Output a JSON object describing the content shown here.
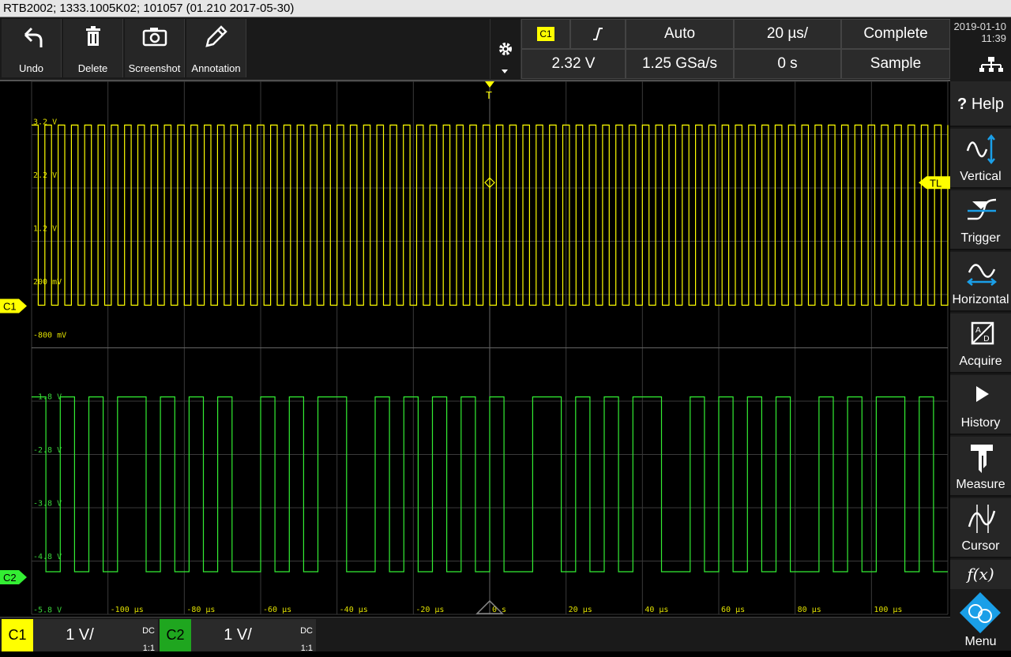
{
  "window": {
    "title": "RTB2002; 1333.1005K02; 101057 (01.210 2017-05-30)"
  },
  "toolbar": {
    "buttons": [
      {
        "label": "Undo",
        "icon": "undo-icon"
      },
      {
        "label": "Delete",
        "icon": "trash-icon"
      },
      {
        "label": "Screenshot",
        "icon": "camera-icon"
      },
      {
        "label": "Annotation",
        "icon": "pencil-icon"
      }
    ]
  },
  "settings": {
    "trigger_source": "C1",
    "trigger_level": "2.32 V",
    "trigger_mode": "Auto",
    "sample_rate": "1.25 GSa/s",
    "timebase": "20 µs/",
    "position": "0 s",
    "acq_status": "Complete",
    "acq_mode": "Sample"
  },
  "datetime": {
    "date": "2019-01-10",
    "time": "11:39"
  },
  "sidebar": {
    "help": "Help",
    "items": [
      {
        "label": "Vertical",
        "icon": "vertical-icon"
      },
      {
        "label": "Trigger",
        "icon": "trigger-icon"
      },
      {
        "label": "Horizontal",
        "icon": "horizontal-icon"
      },
      {
        "label": "Acquire",
        "icon": "acquire-icon"
      },
      {
        "label": "History",
        "icon": "play-icon"
      },
      {
        "label": "Measure",
        "icon": "caliper-icon"
      },
      {
        "label": "Cursor",
        "icon": "cursor-icon"
      }
    ],
    "fx": "f(x)",
    "menu": "Menu"
  },
  "display": {
    "yellow_levels": [
      "3.2 V",
      "2.2 V",
      "1.2 V",
      "200 mV",
      "-800 mV"
    ],
    "green_levels": [
      "-1.8 V",
      "-2.8 V",
      "-3.8 V",
      "-4.8 V",
      "-5.8 V"
    ],
    "time_ticks": [
      "-100 µs",
      "-80 µs",
      "-60 µs",
      "-40 µs",
      "-20 µs",
      "0 s",
      "20 µs",
      "40 µs",
      "60 µs",
      "80 µs",
      "100 µs"
    ],
    "ch1_marker": "C1",
    "ch2_marker": "C2",
    "trigger_level_marker": "TL",
    "trigger_pos_marker": "T"
  },
  "channels": [
    {
      "name": "C1",
      "scale": "1 V/",
      "coupling": "DC",
      "ratio": "1:1",
      "color": "#ffff00"
    },
    {
      "name": "C2",
      "scale": "1 V/",
      "coupling": "DC",
      "ratio": "1:1",
      "color": "#1fa61f"
    }
  ],
  "colors": {
    "ch1": "#ffff00",
    "ch2": "#33ee33",
    "grid": "#3a3a3a",
    "accent": "#1a9fe8"
  }
}
